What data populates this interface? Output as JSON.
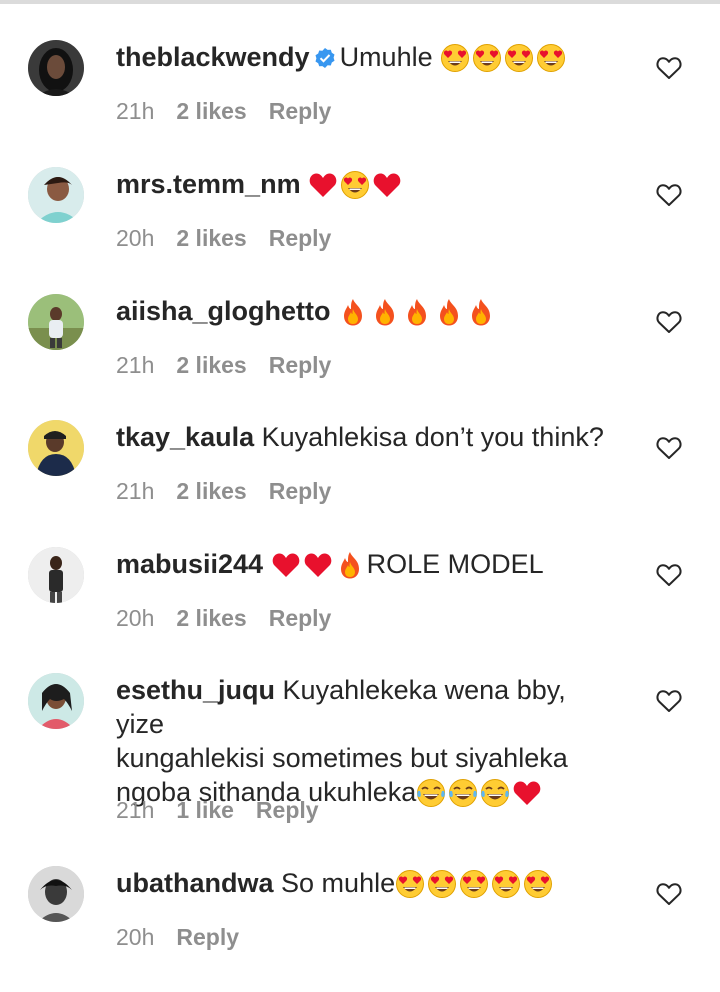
{
  "comments": [
    {
      "username": "theblackwendy",
      "verified": true,
      "text": "Umuhle",
      "emojis": [
        "heart-eyes",
        "heart-eyes",
        "heart-eyes",
        "heart-eyes"
      ],
      "time": "21h",
      "likes": "2 likes",
      "reply": "Reply",
      "avatar_icon": "avatar-woman-dark-hair"
    },
    {
      "username": "mrs.temm_nm",
      "verified": false,
      "text": "",
      "emojis": [
        "red-heart",
        "heart-eyes",
        "red-heart"
      ],
      "time": "20h",
      "likes": "2 likes",
      "reply": "Reply",
      "avatar_icon": "avatar-woman-teal"
    },
    {
      "username": "aiisha_gloghetto",
      "verified": false,
      "text": "",
      "emojis": [
        "fire",
        "fire",
        "fire",
        "fire",
        "fire"
      ],
      "time": "21h",
      "likes": "2 likes",
      "reply": "Reply",
      "avatar_icon": "avatar-outdoor-person"
    },
    {
      "username": "tkay_kaula",
      "verified": false,
      "text": "Kuyahlekisa don’t you think?",
      "emojis": [],
      "time": "21h",
      "likes": "2 likes",
      "reply": "Reply",
      "avatar_icon": "avatar-man-cap"
    },
    {
      "username": "mabusii244",
      "verified": false,
      "text_before_emojis": "",
      "emojis": [
        "red-heart",
        "red-heart",
        "fire"
      ],
      "text": "ROLE MODEL",
      "time": "20h",
      "likes": "2 likes",
      "reply": "Reply",
      "avatar_icon": "avatar-man-standing"
    },
    {
      "username": "esethu_juqu",
      "verified": false,
      "text_line1": "Kuyahlekeka wena bby, yize",
      "text_line2": "kungahlekisi sometimes but siyahleka",
      "text_line3": "ngoba sithanda ukuhleka",
      "emojis": [
        "tears-of-joy",
        "tears-of-joy",
        "tears-of-joy",
        "red-heart"
      ],
      "time": "21h",
      "likes": "1 like",
      "reply": "Reply",
      "avatar_icon": "avatar-woman-braids"
    },
    {
      "username": "ubathandwa",
      "verified": false,
      "text": "So muhle",
      "emojis": [
        "heart-eyes",
        "heart-eyes",
        "heart-eyes",
        "heart-eyes",
        "heart-eyes"
      ],
      "time": "20h",
      "likes": "",
      "reply": "Reply",
      "avatar_icon": "avatar-woman-bw"
    }
  ],
  "icons": {
    "like": "heart-outline-icon",
    "verified": "verified-badge-icon"
  },
  "colors": {
    "text": "#262626",
    "meta": "#8e8e8e",
    "verified": "#3897f0",
    "heart": "#ed1c3a"
  }
}
